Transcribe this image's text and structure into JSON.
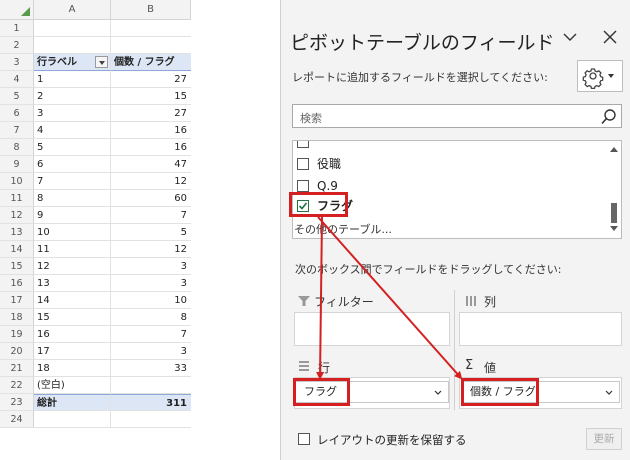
{
  "sheet": {
    "columns": [
      "A",
      "B"
    ],
    "row_numbers": [
      "1",
      "2",
      "3",
      "4",
      "5",
      "6",
      "7",
      "8",
      "9",
      "10",
      "11",
      "12",
      "13",
      "14",
      "15",
      "16",
      "17",
      "18",
      "19",
      "20",
      "21",
      "22",
      "23",
      "24"
    ],
    "pivot_header": {
      "row_label": "行ラベル",
      "value_label": "個数 / フラグ"
    },
    "pivot_rows": [
      {
        "label": "1",
        "value": "27"
      },
      {
        "label": "2",
        "value": "15"
      },
      {
        "label": "3",
        "value": "27"
      },
      {
        "label": "4",
        "value": "16"
      },
      {
        "label": "5",
        "value": "16"
      },
      {
        "label": "6",
        "value": "47"
      },
      {
        "label": "7",
        "value": "12"
      },
      {
        "label": "8",
        "value": "60"
      },
      {
        "label": "9",
        "value": "7"
      },
      {
        "label": "10",
        "value": "5"
      },
      {
        "label": "11",
        "value": "12"
      },
      {
        "label": "12",
        "value": "3"
      },
      {
        "label": "13",
        "value": "3"
      },
      {
        "label": "14",
        "value": "10"
      },
      {
        "label": "15",
        "value": "8"
      },
      {
        "label": "16",
        "value": "7"
      },
      {
        "label": "17",
        "value": "3"
      },
      {
        "label": "18",
        "value": "33"
      },
      {
        "label": "(空白)",
        "value": ""
      }
    ],
    "total": {
      "label": "総計",
      "value": "311"
    }
  },
  "pane": {
    "title": "ピボットテーブルのフィールド",
    "subtitle": "レポートに追加するフィールドを選択してください:",
    "search_placeholder": "検索",
    "fields": [
      {
        "label": "役職",
        "checked": false
      },
      {
        "label": "Q.9",
        "checked": false
      },
      {
        "label": "フラグ",
        "checked": true
      }
    ],
    "more_tables": "その他のテーブル...",
    "drag_hint": "次のボックス間でフィールドをドラッグしてください:",
    "areas": {
      "filter": "フィルター",
      "columns": "列",
      "rows": "行",
      "values": "値"
    },
    "rows_field": "フラグ",
    "values_field": "個数 / フラグ",
    "defer_label": "レイアウトの更新を保留する",
    "update_button": "更新",
    "colors": {
      "highlight": "#d42020",
      "check": "#217346"
    },
    "icons": [
      "gear-icon",
      "search-icon",
      "close-icon",
      "chevron-down-icon",
      "filter-icon",
      "columns-icon",
      "rows-icon",
      "sigma-icon"
    ]
  }
}
